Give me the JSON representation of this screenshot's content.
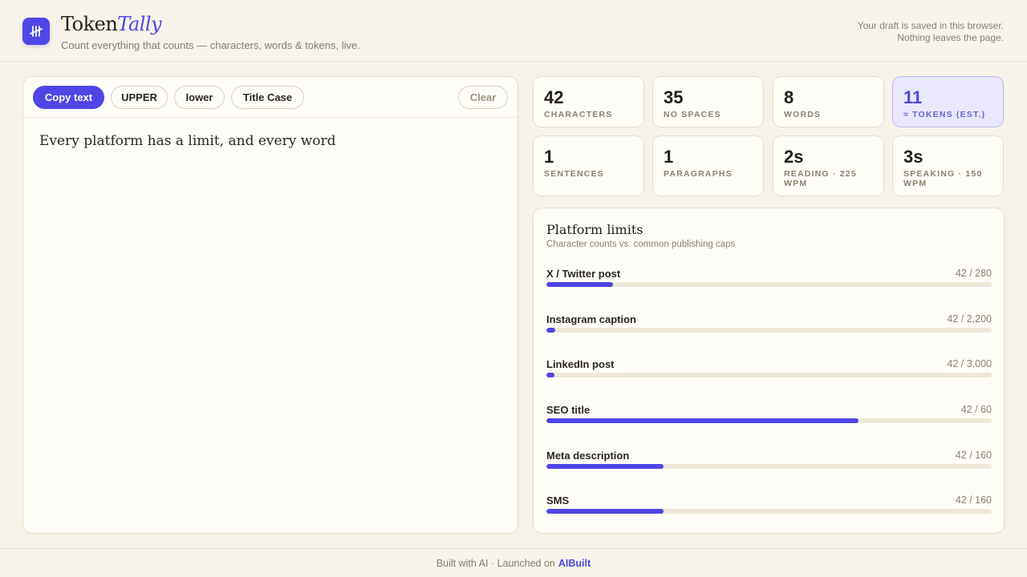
{
  "header": {
    "logo_icon": "tally-marks-icon",
    "brand_main": "Token",
    "brand_accent": "Tally",
    "tagline": "Count everything that counts — characters, words & tokens, live.",
    "draft_note_line1": "Your draft is saved in this browser.",
    "draft_note_line2": "Nothing leaves the page."
  },
  "toolbar": {
    "copy_label": "Copy text",
    "upper_label": "UPPER",
    "lower_label": "lower",
    "title_label": "Title Case",
    "clear_label": "Clear"
  },
  "editor": {
    "text": "Every platform has a limit, and every word"
  },
  "stats": [
    {
      "value": "42",
      "label": "CHARACTERS"
    },
    {
      "value": "35",
      "label": "NO SPACES"
    },
    {
      "value": "8",
      "label": "WORDS"
    },
    {
      "value": "11",
      "label": "≈ TOKENS (EST.)"
    },
    {
      "value": "1",
      "label": "SENTENCES"
    },
    {
      "value": "1",
      "label": "PARAGRAPHS"
    },
    {
      "value": "2s",
      "label": "READING · 225 WPM"
    },
    {
      "value": "3s",
      "label": "SPEAKING · 150 WPM"
    }
  ],
  "limits": {
    "title": "Platform limits",
    "subtitle": "Character counts vs. common publishing caps",
    "items": [
      {
        "name": "X / Twitter post",
        "count": "42 / 280",
        "used": 42,
        "max": 280
      },
      {
        "name": "Instagram caption",
        "count": "42 / 2,200",
        "used": 42,
        "max": 2200
      },
      {
        "name": "LinkedIn post",
        "count": "42 / 3,000",
        "used": 42,
        "max": 3000
      },
      {
        "name": "SEO title",
        "count": "42 / 60",
        "used": 42,
        "max": 60
      },
      {
        "name": "Meta description",
        "count": "42 / 160",
        "used": 42,
        "max": 160
      },
      {
        "name": "SMS",
        "count": "42 / 160",
        "used": 42,
        "max": 160
      }
    ]
  },
  "footer": {
    "text": "Built with AI · Launched on",
    "link": "AIBuilt"
  },
  "colors": {
    "accent": "#4f46e5",
    "background": "#f6f2e8",
    "card": "#fffdf7"
  }
}
